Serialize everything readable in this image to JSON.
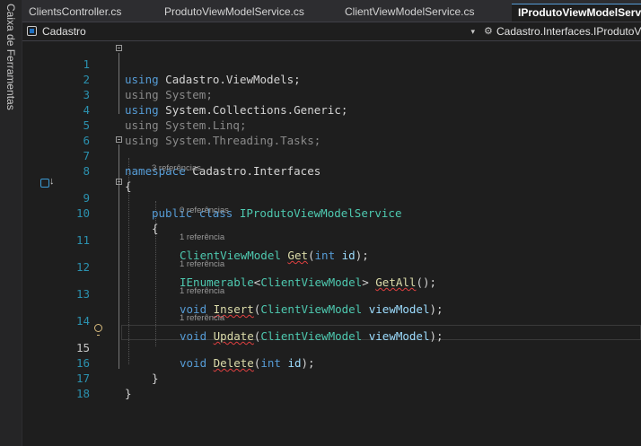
{
  "toolbox": {
    "label": "Caixa de Ferramentas"
  },
  "tabs": [
    {
      "label": "ClientsController.cs",
      "active": false
    },
    {
      "label": "ProdutoViewModelService.cs",
      "active": false
    },
    {
      "label": "ClientViewModelService.cs",
      "active": false
    },
    {
      "label": "IProdutoViewModelService.cs",
      "active": true
    }
  ],
  "navbar": {
    "project": "Cadastro",
    "type_path": "Cadastro.Interfaces.IProdutoViewModelService",
    "dropdown_glyph": "▾"
  },
  "editor": {
    "line_numbers": [
      "1",
      "2",
      "3",
      "4",
      "5",
      "6",
      "7",
      "8",
      "9",
      "10",
      "11",
      "12",
      "13",
      "14",
      "15",
      "16",
      "17",
      "18"
    ],
    "references": {
      "class": "3 referências",
      "get": "0 referências",
      "getall": "1 referência",
      "insert": "1 referência",
      "update": "1 referência",
      "delete": "1 referência"
    },
    "tokens": {
      "using": "using",
      "ns_cadastro_viewmodels": "Cadastro.ViewModels",
      "ns_system": "System",
      "ns_system_collections": "System.Collections.Generic",
      "ns_system_linq": "System.Linq",
      "ns_system_threading": "System.Threading.Tasks",
      "semi": ";",
      "namespace": "namespace",
      "ns_interfaces": "Cadastro.Interfaces",
      "open_brace": "{",
      "close_brace": "}",
      "public": "public",
      "class": "class",
      "class_name": "IProdutoViewModelService",
      "client_view_model": "ClientViewModel",
      "get": "Get",
      "int": "int",
      "id": "id",
      "ienumerable": "IEnumerable",
      "lt": "<",
      "gt": ">",
      "getall": "GetAll",
      "empty_params": "();",
      "void": "void",
      "insert": "Insert",
      "update": "Update",
      "delete": "Delete",
      "view_model": "viewModel",
      "open_paren": "(",
      "close_paren_semi": ");",
      "space": " "
    }
  },
  "colors": {
    "keyword": "#569cd6",
    "type": "#4ec9b0",
    "method": "#dcdcaa",
    "parameter": "#9cdcfe",
    "line_number": "#2b91af"
  }
}
